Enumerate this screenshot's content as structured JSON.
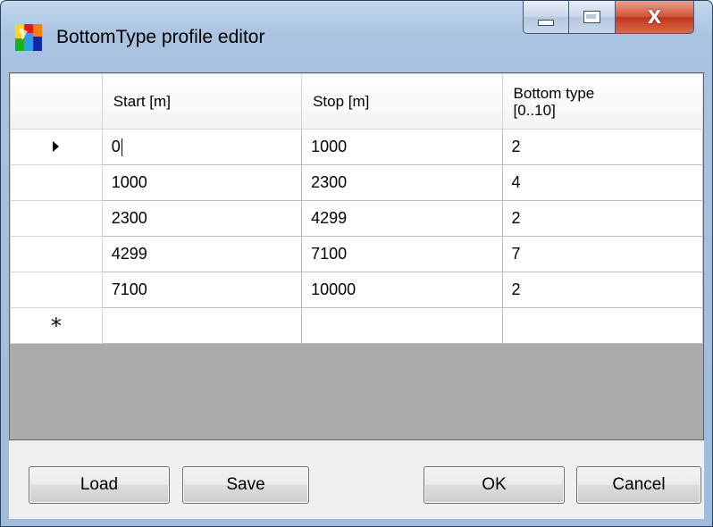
{
  "window": {
    "title": "BottomType profile editor",
    "icon": "app-color-icon",
    "close_symbol": "X"
  },
  "grid": {
    "columns": [
      "Start [m]",
      "Stop [m]",
      "Bottom type\n[0..10]"
    ],
    "column_header_lines": [
      [
        "Start [m]"
      ],
      [
        "Stop [m]"
      ],
      [
        "Bottom type",
        "[0..10]"
      ]
    ],
    "rows": [
      {
        "start": "0",
        "stop": "1000",
        "bottom_type": "2",
        "current": true
      },
      {
        "start": "1000",
        "stop": "2300",
        "bottom_type": "4"
      },
      {
        "start": "2300",
        "stop": "4299",
        "bottom_type": "2"
      },
      {
        "start": "4299",
        "stop": "7100",
        "bottom_type": "7"
      },
      {
        "start": "7100",
        "stop": "10000",
        "bottom_type": "2"
      }
    ],
    "new_row_symbol": "*",
    "current_row_icon": "row-pointer-icon",
    "new_row_icon": "new-row-asterisk-icon"
  },
  "buttons": {
    "load": "Load",
    "save": "Save",
    "ok": "OK",
    "cancel": "Cancel"
  },
  "colors": {
    "grid_background": "#ababab",
    "close_button": "#c8452c"
  }
}
